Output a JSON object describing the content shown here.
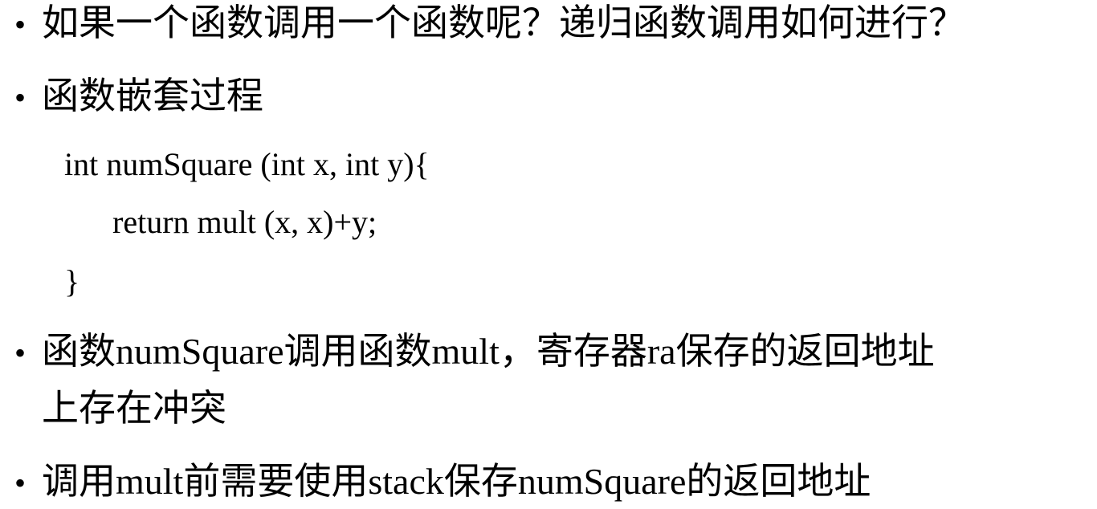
{
  "bullet_char": "•",
  "bullets": {
    "b1": "如果一个函数调用一个函数呢？递归函数调用如何进行？",
    "b2": "函数嵌套过程",
    "b3_line1": "函数numSquare调用函数mult，寄存器ra保存的返回地址",
    "b3_line2": "上存在冲突",
    "b4": "调用mult前需要使用stack保存numSquare的返回地址"
  },
  "code": {
    "line1": "int numSquare (int x, int y){",
    "line2": "return mult (x, x)+y;",
    "line3": "}"
  }
}
